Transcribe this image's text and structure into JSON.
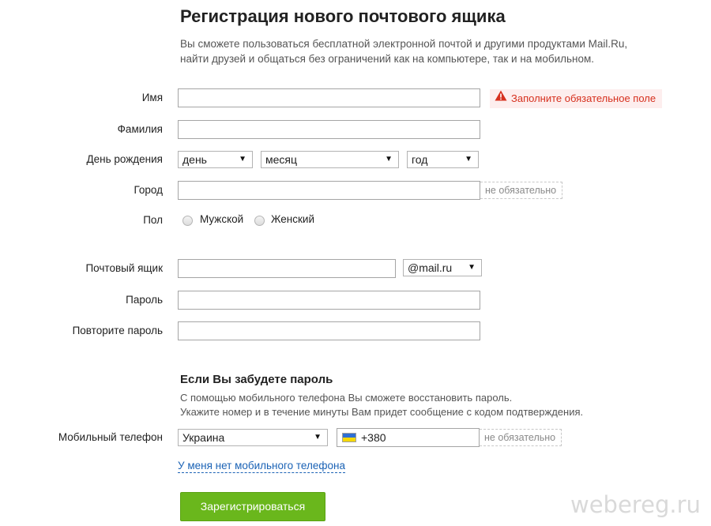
{
  "header": {
    "title": "Регистрация нового почтового ящика",
    "subtitle_line1": "Вы сможете пользоваться бесплатной электронной почтой и другими продуктами Mail.Ru,",
    "subtitle_line2": "найти друзей и общаться без ограничений как на компьютере, так и на мобильном."
  },
  "form": {
    "first_name": {
      "label": "Имя",
      "value": ""
    },
    "error": {
      "text": "Заполните обязательное поле",
      "icon": "warning-icon",
      "color": "#d6301e"
    },
    "last_name": {
      "label": "Фамилия",
      "value": ""
    },
    "birthday": {
      "label": "День рождения",
      "day": "день",
      "month": "месяц",
      "year": "год"
    },
    "city": {
      "label": "Город",
      "value": "",
      "hint": "не обязательно"
    },
    "gender": {
      "label": "Пол",
      "male": "Мужской",
      "female": "Женский"
    },
    "mailbox": {
      "label": "Почтовый ящик",
      "value": "",
      "domain": "@mail.ru"
    },
    "password": {
      "label": "Пароль",
      "value": ""
    },
    "password_repeat": {
      "label": "Повторите пароль",
      "value": ""
    }
  },
  "recovery": {
    "title": "Если Вы забудете пароль",
    "text_line1": "С помощью мобильного телефона Вы сможете восстановить пароль.",
    "text_line2": "Укажите номер и в течение минуты Вам придет сообщение с кодом подтверждения.",
    "phone_label": "Мобильный телефон",
    "country": "Украина",
    "phone_value": "+380",
    "phone_hint": "не обязательно",
    "no_phone_link": "У меня нет мобильного телефона"
  },
  "submit_label": "Зарегистрироваться",
  "watermark": "webereg.ru",
  "colors": {
    "accent_green": "#6ab71c",
    "link_blue": "#1a62b5"
  }
}
